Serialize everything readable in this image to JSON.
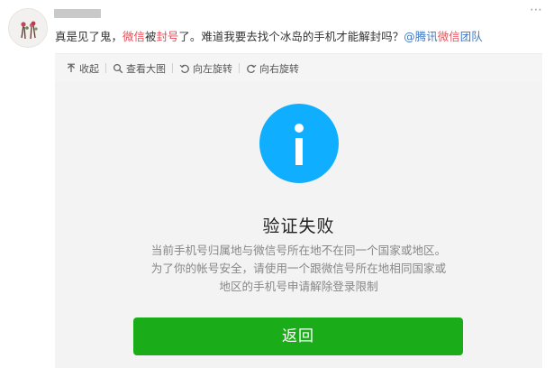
{
  "post": {
    "text_1": "真是见了鬼，",
    "kw_1": "微信",
    "text_2": "被",
    "kw_2": "封号",
    "text_3": "了。难道我要去找个冰岛的手机才能解封吗？",
    "mention_1": "@腾讯",
    "mention_kw": "微信",
    "mention_2": "团队"
  },
  "header": {
    "more_icon": "more-dots-icon"
  },
  "toolbar": {
    "items": [
      {
        "label": "收起",
        "icon": "collapse-icon"
      },
      {
        "label": "查看大图",
        "icon": "magnify-icon"
      },
      {
        "label": "向左旋转",
        "icon": "rotate-left-icon"
      },
      {
        "label": "向右旋转",
        "icon": "rotate-right-icon"
      }
    ]
  },
  "dialog": {
    "title": "验证失败",
    "lines": [
      "当前手机号归属地与微信号所在地不在同一个国家或地区。",
      "为了你的帐号安全，请使用一个跟微信号所在地相同国家或",
      "地区的手机号申请解除登录限制"
    ],
    "button_label": "返回",
    "info_icon": "info-icon"
  },
  "colors": {
    "accent_green": "#1aad19",
    "info_blue": "#10aeff",
    "keyword_red": "#eb4a55",
    "mention_blue": "#3f78c4"
  }
}
